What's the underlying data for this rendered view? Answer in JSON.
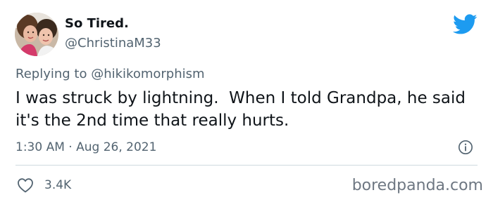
{
  "author": {
    "display_name": "So Tired.",
    "handle": "@ChristinaM33"
  },
  "reply": {
    "prefix": "Replying to ",
    "mention": "@hikikomorphism"
  },
  "tweet": {
    "text": "I was struck by lightning.  When I told Grandpa, he said it's the 2nd time that really hurts."
  },
  "meta": {
    "time": "1:30 AM",
    "separator": " · ",
    "date": "Aug 26, 2021"
  },
  "actions": {
    "like_count": "3.4K"
  },
  "watermark": "boredpanda.com",
  "icons": {
    "brand": "twitter-bird-icon",
    "info": "info-icon",
    "like": "heart-icon"
  },
  "colors": {
    "twitter_blue": "#1d9bf0",
    "text_primary": "#0f1419",
    "text_secondary": "#536471",
    "divider": "#cfd9de"
  }
}
